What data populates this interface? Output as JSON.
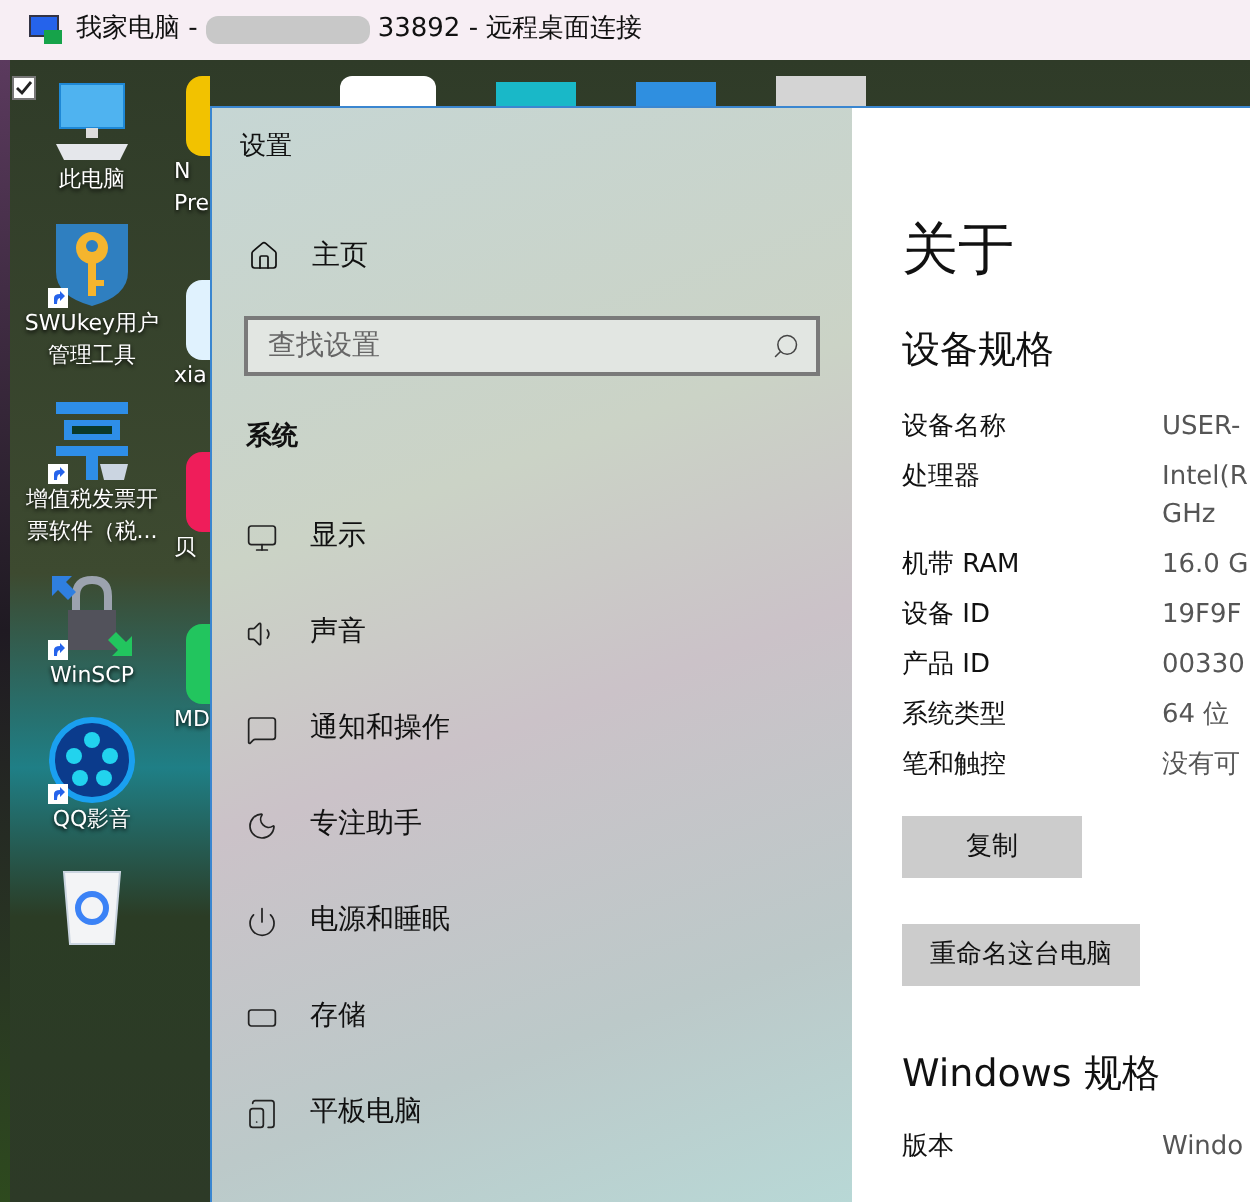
{
  "title_bar": {
    "title_start": "我家电脑 -",
    "title_end": "33892 - 远程桌面连接"
  },
  "desktop_icons": [
    {
      "kind": "computer",
      "lines": [
        "此电脑"
      ],
      "checked": true
    },
    {
      "kind": "key",
      "lines": [
        "SWUkey用户",
        "管理工具"
      ],
      "checked": false
    },
    {
      "kind": "ticket",
      "lines": [
        "增值税发票开",
        "票软件（税..."
      ],
      "checked": false
    },
    {
      "kind": "lock",
      "lines": [
        "WinSCP"
      ],
      "checked": false
    },
    {
      "kind": "player",
      "lines": [
        "QQ影音"
      ],
      "checked": false
    },
    {
      "kind": "recycle",
      "checked": false
    }
  ],
  "desktop_icons_column_2": [
    {
      "kind": "yellow",
      "lines": [
        "N",
        "Pre"
      ]
    },
    {
      "kind": "blue",
      "lines": [
        "xia"
      ]
    },
    {
      "kind": "red",
      "lines": [
        "贝"
      ]
    },
    {
      "kind": "green",
      "lines": [
        "MD"
      ]
    }
  ],
  "settings": {
    "window_title": "设置",
    "home": "主页",
    "search": {
      "placeholder": "查找设置"
    },
    "section": "系统",
    "nav_items": [
      {
        "kind": "display",
        "label": "显示"
      },
      {
        "kind": "sound",
        "label": "声音"
      },
      {
        "kind": "notify",
        "label": "通知和操作"
      },
      {
        "kind": "focus",
        "label": "专注助手"
      },
      {
        "kind": "power",
        "label": "电源和睡眠"
      },
      {
        "kind": "storage",
        "label": "存储"
      },
      {
        "kind": "tablet",
        "label": "平板电脑"
      }
    ],
    "page_title": "关于",
    "specs_heading": "设备规格",
    "specs": [
      {
        "label": "设备名称",
        "value": [
          "USER-"
        ]
      },
      {
        "label": "处理器",
        "value": [
          "Intel(R",
          "GHz"
        ]
      },
      {
        "label": "机带 RAM",
        "value": [
          "16.0 G"
        ]
      },
      {
        "label": "设备 ID",
        "value": [
          "19F9F"
        ]
      },
      {
        "label": "产品 ID",
        "value": [
          "00330"
        ]
      },
      {
        "label": "系统类型",
        "value": [
          "64 位"
        ]
      },
      {
        "label": "笔和触控",
        "value": [
          "没有可"
        ]
      }
    ],
    "buttons": [
      "复制",
      "重命名这台电脑"
    ],
    "windows_heading": "Windows 规格",
    "windows_specs": [
      {
        "label": "版本",
        "value": [
          "Windo"
        ]
      }
    ]
  }
}
